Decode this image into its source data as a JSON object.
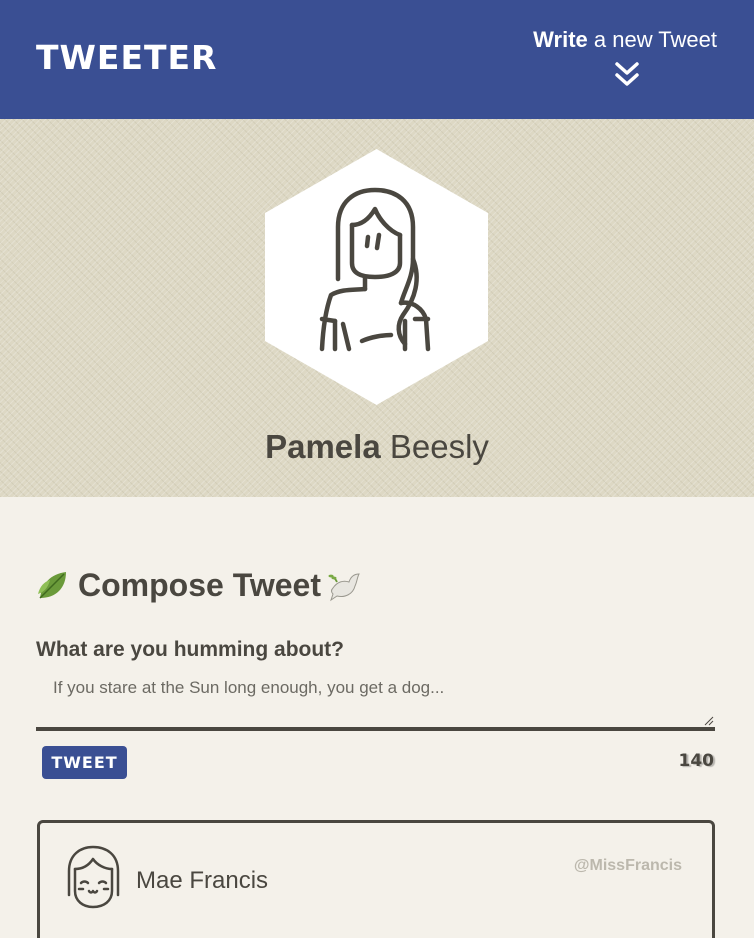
{
  "nav": {
    "brand": "TWEETER",
    "write_bold": "Write",
    "write_rest": " a new Tweet"
  },
  "profile": {
    "first_name": "Pamela",
    "last_name": " Beesly"
  },
  "compose": {
    "title": "Compose Tweet",
    "label": "What are you humming about?",
    "placeholder": "If you stare at the Sun long enough, you get a dog...",
    "button": "TWEET",
    "counter": "140"
  },
  "tweet": {
    "author": "Mae Francis",
    "handle": "@MissFrancis"
  },
  "colors": {
    "nav": "#3a4f93",
    "text": "#4a4740",
    "background": "#f4f1ea",
    "handle": "#bcb8ad"
  },
  "icons": [
    "double-chevron-down-icon",
    "leaf-icon",
    "dove-icon",
    "textarea-resize-icon"
  ]
}
